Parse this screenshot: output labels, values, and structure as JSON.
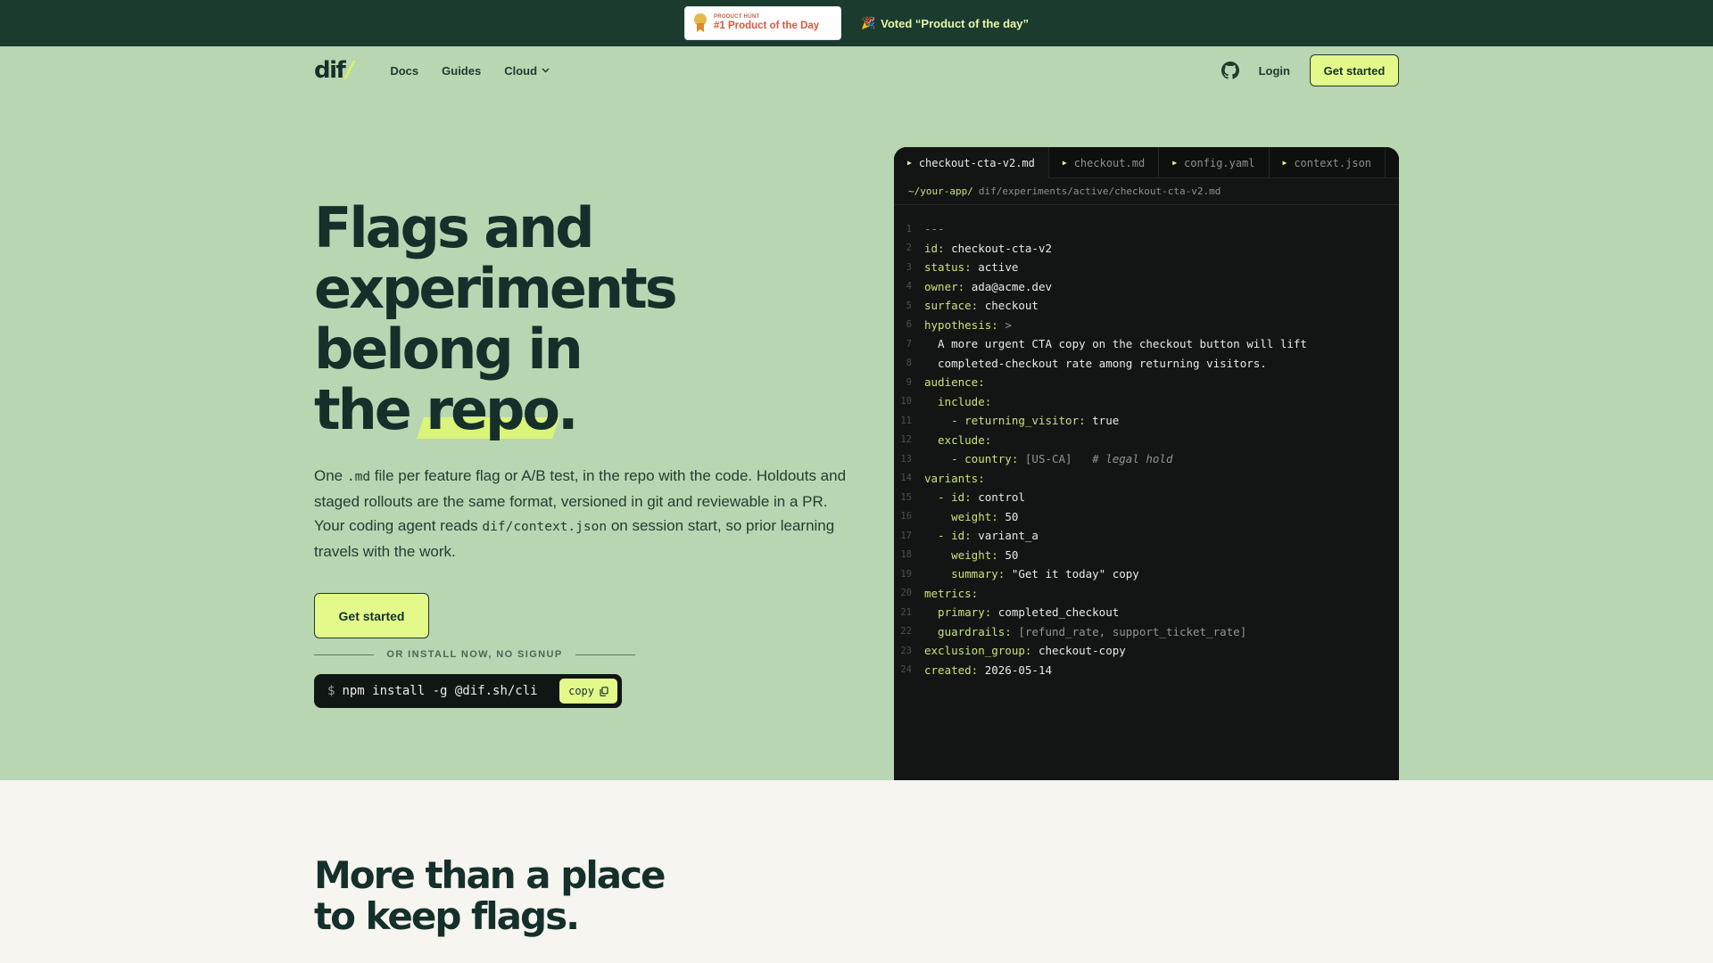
{
  "banner": {
    "badge_small": "PRODUCT HUNT",
    "badge_big": "#1 Product of the Day",
    "voted_emoji": "🎉",
    "voted_text": "Voted “Product of the day”"
  },
  "nav": {
    "logo": "dif",
    "links": [
      "Docs",
      "Guides",
      "Cloud"
    ],
    "login": "Login",
    "cta": "Get started"
  },
  "hero": {
    "title_lines": [
      "Flags and",
      "experiments",
      "belong in",
      "the "
    ],
    "title_highlight": "repo",
    "title_end": ".",
    "desc_1": "One ",
    "desc_code_1": ".md",
    "desc_2": " file per feature flag or A/B test, in the repo with the code. Holdouts and staged rollouts are the same format, versioned in git and reviewable in a PR. Your coding agent reads ",
    "desc_code_2": "dif/context.json",
    "desc_3": " on session start, so prior learning travels with the work.",
    "cta": "Get started",
    "or_label": "OR INSTALL NOW, NO SIGNUP",
    "install_prompt": "$",
    "install_cmd": "npm install -g @dif.sh/cli",
    "copy_label": "copy"
  },
  "editor": {
    "tabs": [
      "checkout-cta-v2.md",
      "checkout.md",
      "config.yaml",
      "context.json"
    ],
    "path_base": "~/your-app/",
    "path_rest": "dif/experiments/active/checkout-cta-v2.md",
    "lines": [
      {
        "n": "1",
        "parts": [
          [
            "m",
            "---"
          ]
        ]
      },
      {
        "n": "2",
        "parts": [
          [
            "k",
            "id: "
          ],
          [
            "t",
            "checkout-cta-v2"
          ]
        ]
      },
      {
        "n": "3",
        "parts": [
          [
            "k",
            "status: "
          ],
          [
            "t",
            "active"
          ]
        ]
      },
      {
        "n": "4",
        "parts": [
          [
            "k",
            "owner: "
          ],
          [
            "t",
            "ada@acme.dev"
          ]
        ]
      },
      {
        "n": "5",
        "parts": [
          [
            "k",
            "surface: "
          ],
          [
            "t",
            "checkout"
          ]
        ]
      },
      {
        "n": "6",
        "parts": [
          [
            "k",
            "hypothesis: "
          ],
          [
            "m",
            ">"
          ]
        ]
      },
      {
        "n": "7",
        "parts": [
          [
            "t",
            "  A more urgent CTA copy on the checkout button will lift"
          ]
        ]
      },
      {
        "n": "8",
        "parts": [
          [
            "t",
            "  completed-checkout rate among returning visitors."
          ]
        ]
      },
      {
        "n": "9",
        "parts": [
          [
            "k",
            "audience:"
          ]
        ]
      },
      {
        "n": "10",
        "parts": [
          [
            "k",
            "  include:"
          ]
        ]
      },
      {
        "n": "11",
        "parts": [
          [
            "k",
            "    - returning_visitor: "
          ],
          [
            "t",
            "true"
          ]
        ]
      },
      {
        "n": "12",
        "parts": [
          [
            "k",
            "  exclude:"
          ]
        ]
      },
      {
        "n": "13",
        "parts": [
          [
            "k",
            "    - country: "
          ],
          [
            "m",
            "[US-CA]"
          ],
          [
            "t",
            "   "
          ],
          [
            "c",
            "# legal hold"
          ]
        ]
      },
      {
        "n": "14",
        "parts": [
          [
            "k",
            "variants:"
          ]
        ]
      },
      {
        "n": "15",
        "parts": [
          [
            "k",
            "  - id: "
          ],
          [
            "t",
            "control"
          ]
        ]
      },
      {
        "n": "16",
        "parts": [
          [
            "k",
            "    weight: "
          ],
          [
            "t",
            "50"
          ]
        ]
      },
      {
        "n": "17",
        "parts": [
          [
            "k",
            "  - id: "
          ],
          [
            "t",
            "variant_a"
          ]
        ]
      },
      {
        "n": "18",
        "parts": [
          [
            "k",
            "    weight: "
          ],
          [
            "t",
            "50"
          ]
        ]
      },
      {
        "n": "19",
        "parts": [
          [
            "k",
            "    summary: "
          ],
          [
            "t",
            "\"Get it today\" copy"
          ]
        ]
      },
      {
        "n": "20",
        "parts": [
          [
            "k",
            "metrics:"
          ]
        ]
      },
      {
        "n": "21",
        "parts": [
          [
            "k",
            "  primary: "
          ],
          [
            "t",
            "completed_checkout"
          ]
        ]
      },
      {
        "n": "22",
        "parts": [
          [
            "k",
            "  guardrails: "
          ],
          [
            "m",
            "[refund_rate, support_ticket_rate]"
          ]
        ]
      },
      {
        "n": "23",
        "parts": [
          [
            "k",
            "exclusion_group: "
          ],
          [
            "t",
            "checkout-copy"
          ]
        ]
      },
      {
        "n": "24",
        "parts": [
          [
            "k",
            "created: "
          ],
          [
            "t",
            "2026-05-14"
          ]
        ]
      }
    ]
  },
  "lower": {
    "title_lines": [
      "More than a place",
      "to keep flags."
    ]
  },
  "colors": {
    "banner_bg": "#1b3b2f",
    "page_bg": "#b9d6b2",
    "accent": "#e3fa8b",
    "editor_bg": "#121514"
  }
}
